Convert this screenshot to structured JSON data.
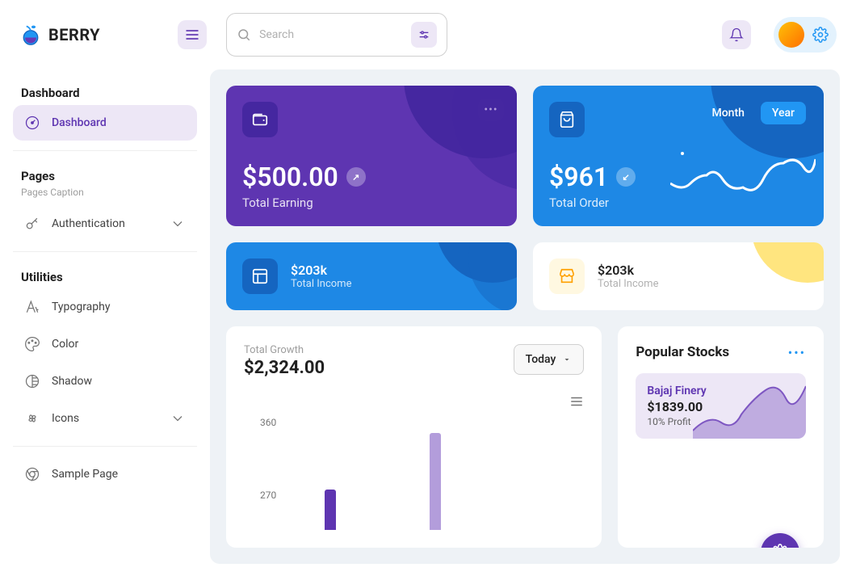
{
  "brand": "BERRY",
  "search": {
    "placeholder": "Search"
  },
  "sidebar": {
    "dashboard_section": "Dashboard",
    "dashboard": "Dashboard",
    "pages_section": "Pages",
    "pages_caption": "Pages Caption",
    "authentication": "Authentication",
    "utilities_section": "Utilities",
    "typography": "Typography",
    "color": "Color",
    "shadow": "Shadow",
    "icons": "Icons",
    "sample_page": "Sample Page"
  },
  "cards": {
    "earning": {
      "value": "$500.00",
      "label": "Total Earning"
    },
    "order": {
      "value": "$961",
      "label": "Total Order",
      "toggle_month": "Month",
      "toggle_year": "Year"
    },
    "income1": {
      "value": "$203k",
      "label": "Total Income"
    },
    "income2": {
      "value": "$203k",
      "label": "Total Income"
    }
  },
  "growth": {
    "label": "Total Growth",
    "value": "$2,324.00",
    "dropdown": "Today"
  },
  "stocks": {
    "title": "Popular Stocks",
    "item": {
      "name": "Bajaj Finery",
      "price": "$1839.00",
      "profit": "10% Profit"
    }
  },
  "chart_data": {
    "type": "bar",
    "y_ticks": [
      360,
      270
    ],
    "series_visible": [
      {
        "color": "purple",
        "x_index": 0,
        "top_value": 300
      },
      {
        "color": "lavender",
        "x_index": 1,
        "top_value": 360
      }
    ]
  }
}
